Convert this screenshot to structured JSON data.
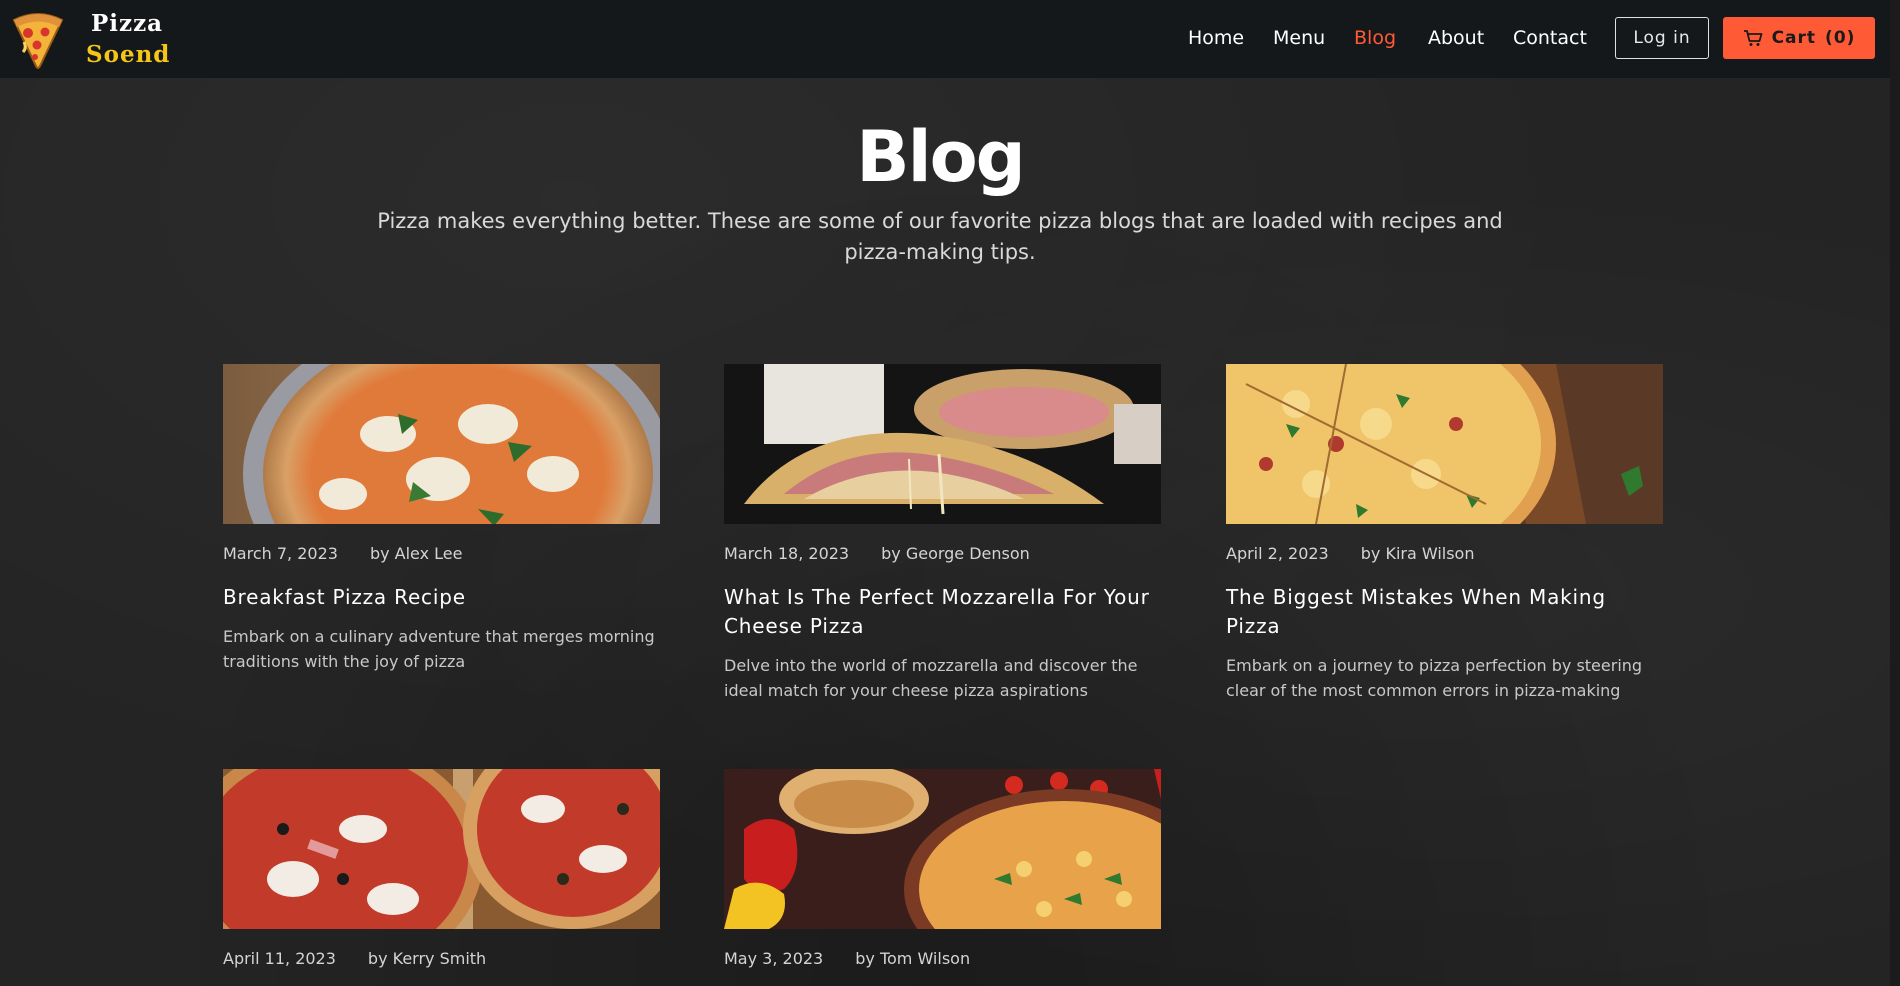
{
  "brand": {
    "line1": "Pizza",
    "line2": "Soend",
    "logo_icon": "pizza-slice-icon"
  },
  "nav": {
    "links": [
      {
        "label": "Home",
        "active": false
      },
      {
        "label": "Menu",
        "active": false
      },
      {
        "label": "Blog",
        "active": true
      },
      {
        "label": "About",
        "active": false
      },
      {
        "label": "Contact",
        "active": false
      }
    ],
    "login_label": "Log in",
    "cart_label": "Cart",
    "cart_count": "(0)",
    "cart_icon": "cart-icon"
  },
  "hero": {
    "title": "Blog",
    "subtitle": "Pizza makes everything better. These are some of our favorite pizza blogs that are loaded with recipes and pizza-making tips."
  },
  "posts": [
    {
      "date": "March 7, 2023",
      "author": "by Alex Lee",
      "title": "Breakfast Pizza Recipe",
      "excerpt": "Embark on a culinary adventure that merges morning traditions with the joy of pizza"
    },
    {
      "date": "March 18, 2023",
      "author": "by George Denson",
      "title": "What Is The Perfect Mozzarella For Your Cheese Pizza",
      "excerpt": "Delve into the world of mozzarella and discover the ideal match for your cheese pizza aspirations"
    },
    {
      "date": "April 2, 2023",
      "author": "by Kira Wilson",
      "title": "The Biggest Mistakes When Making Pizza",
      "excerpt": "Embark on a journey to pizza perfection by steering clear of the most common errors in pizza-making"
    },
    {
      "date": "April 11, 2023",
      "author": "by Kerry Smith",
      "title": "",
      "excerpt": ""
    },
    {
      "date": "May 3, 2023",
      "author": "by Tom Wilson",
      "title": "",
      "excerpt": ""
    }
  ],
  "colors": {
    "accent": "#ff5a36",
    "navbar_bg": "#15181b",
    "page_bg": "#242424",
    "brand_yellow": "#f5c518"
  }
}
